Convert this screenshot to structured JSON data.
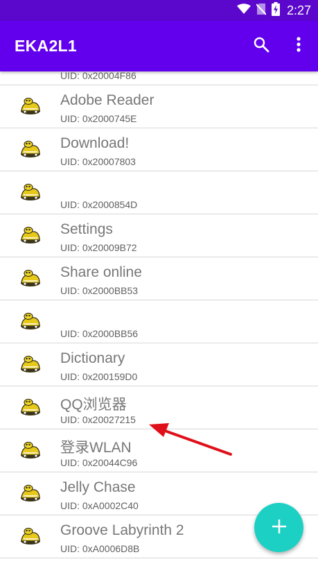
{
  "status_bar": {
    "time": "2:27",
    "icons": [
      "wifi-icon",
      "no-sim-icon",
      "battery-charging-icon"
    ],
    "background": "#5b08cc"
  },
  "app_bar": {
    "title": "EKA2L1",
    "background": "#6200ee",
    "actions": [
      "search-icon",
      "more-vert-icon"
    ]
  },
  "apps": [
    {
      "name": "",
      "uid": "UID: 0x20004F86"
    },
    {
      "name": "Adobe Reader",
      "uid": "UID: 0x2000745E"
    },
    {
      "name": "Download!",
      "uid": "UID: 0x20007803"
    },
    {
      "name": "",
      "uid": "UID: 0x2000854D"
    },
    {
      "name": "Settings",
      "uid": "UID: 0x20009B72"
    },
    {
      "name": "Share online",
      "uid": "UID: 0x2000BB53"
    },
    {
      "name": "",
      "uid": "UID: 0x2000BB56"
    },
    {
      "name": "Dictionary",
      "uid": "UID: 0x200159D0"
    },
    {
      "name": "QQ浏览器",
      "uid": "UID: 0x20027215"
    },
    {
      "name": "登录WLAN",
      "uid": "UID: 0x20044C96"
    },
    {
      "name": "Jelly Chase",
      "uid": "UID: 0xA0002C40"
    },
    {
      "name": "Groove Labyrinth 2",
      "uid": "UID: 0xA0006D8B"
    }
  ],
  "app_icon": "symbian-app-icon",
  "fab": {
    "icon": "plus-icon",
    "color": "#1cd1c4"
  },
  "annotation": {
    "type": "red-arrow",
    "color": "#e0101a"
  }
}
